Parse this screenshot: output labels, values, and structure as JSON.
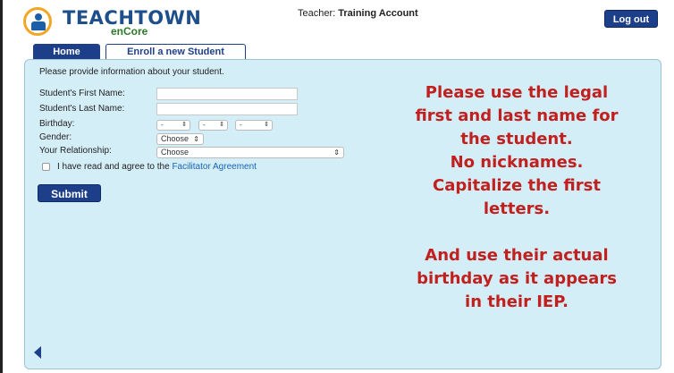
{
  "header": {
    "logo_text": "TEACHTOWN",
    "logo_sub": "enCore",
    "teacher_label": "Teacher:",
    "teacher_name": "Training Account",
    "logout_label": "Log out"
  },
  "tabs": [
    {
      "label": "Home",
      "active": true
    },
    {
      "label": "Enroll a new Student",
      "active": false
    }
  ],
  "form": {
    "intro": "Please provide information about your student.",
    "first_name_label": "Student's First Name:",
    "first_name_value": "",
    "last_name_label": "Student's Last Name:",
    "last_name_value": "",
    "birthday_label": "Birthday:",
    "birthday_month": "-",
    "birthday_day": "-",
    "birthday_year": "-",
    "gender_label": "Gender:",
    "gender_value": "Choose",
    "relationship_label": "Your Relationship:",
    "relationship_value": "Choose",
    "agree_text": "I have read and agree to the",
    "agree_link": "Facilitator Agreement",
    "submit_label": "Submit"
  },
  "notice_lines": [
    "Please use the legal",
    "first and last name for",
    "the student.",
    "No nicknames.",
    "Capitalize the first",
    "letters.",
    "",
    "And use their actual",
    "birthday as it appears",
    "in their IEP."
  ],
  "colors": {
    "panel_bg": "#d4eef7",
    "primary_button": "#1d3f8a",
    "notice_text": "#c2201f",
    "link": "#1a62b4"
  },
  "icons": {
    "logo": "teachtown-logo-icon",
    "back": "back-arrow-icon"
  }
}
